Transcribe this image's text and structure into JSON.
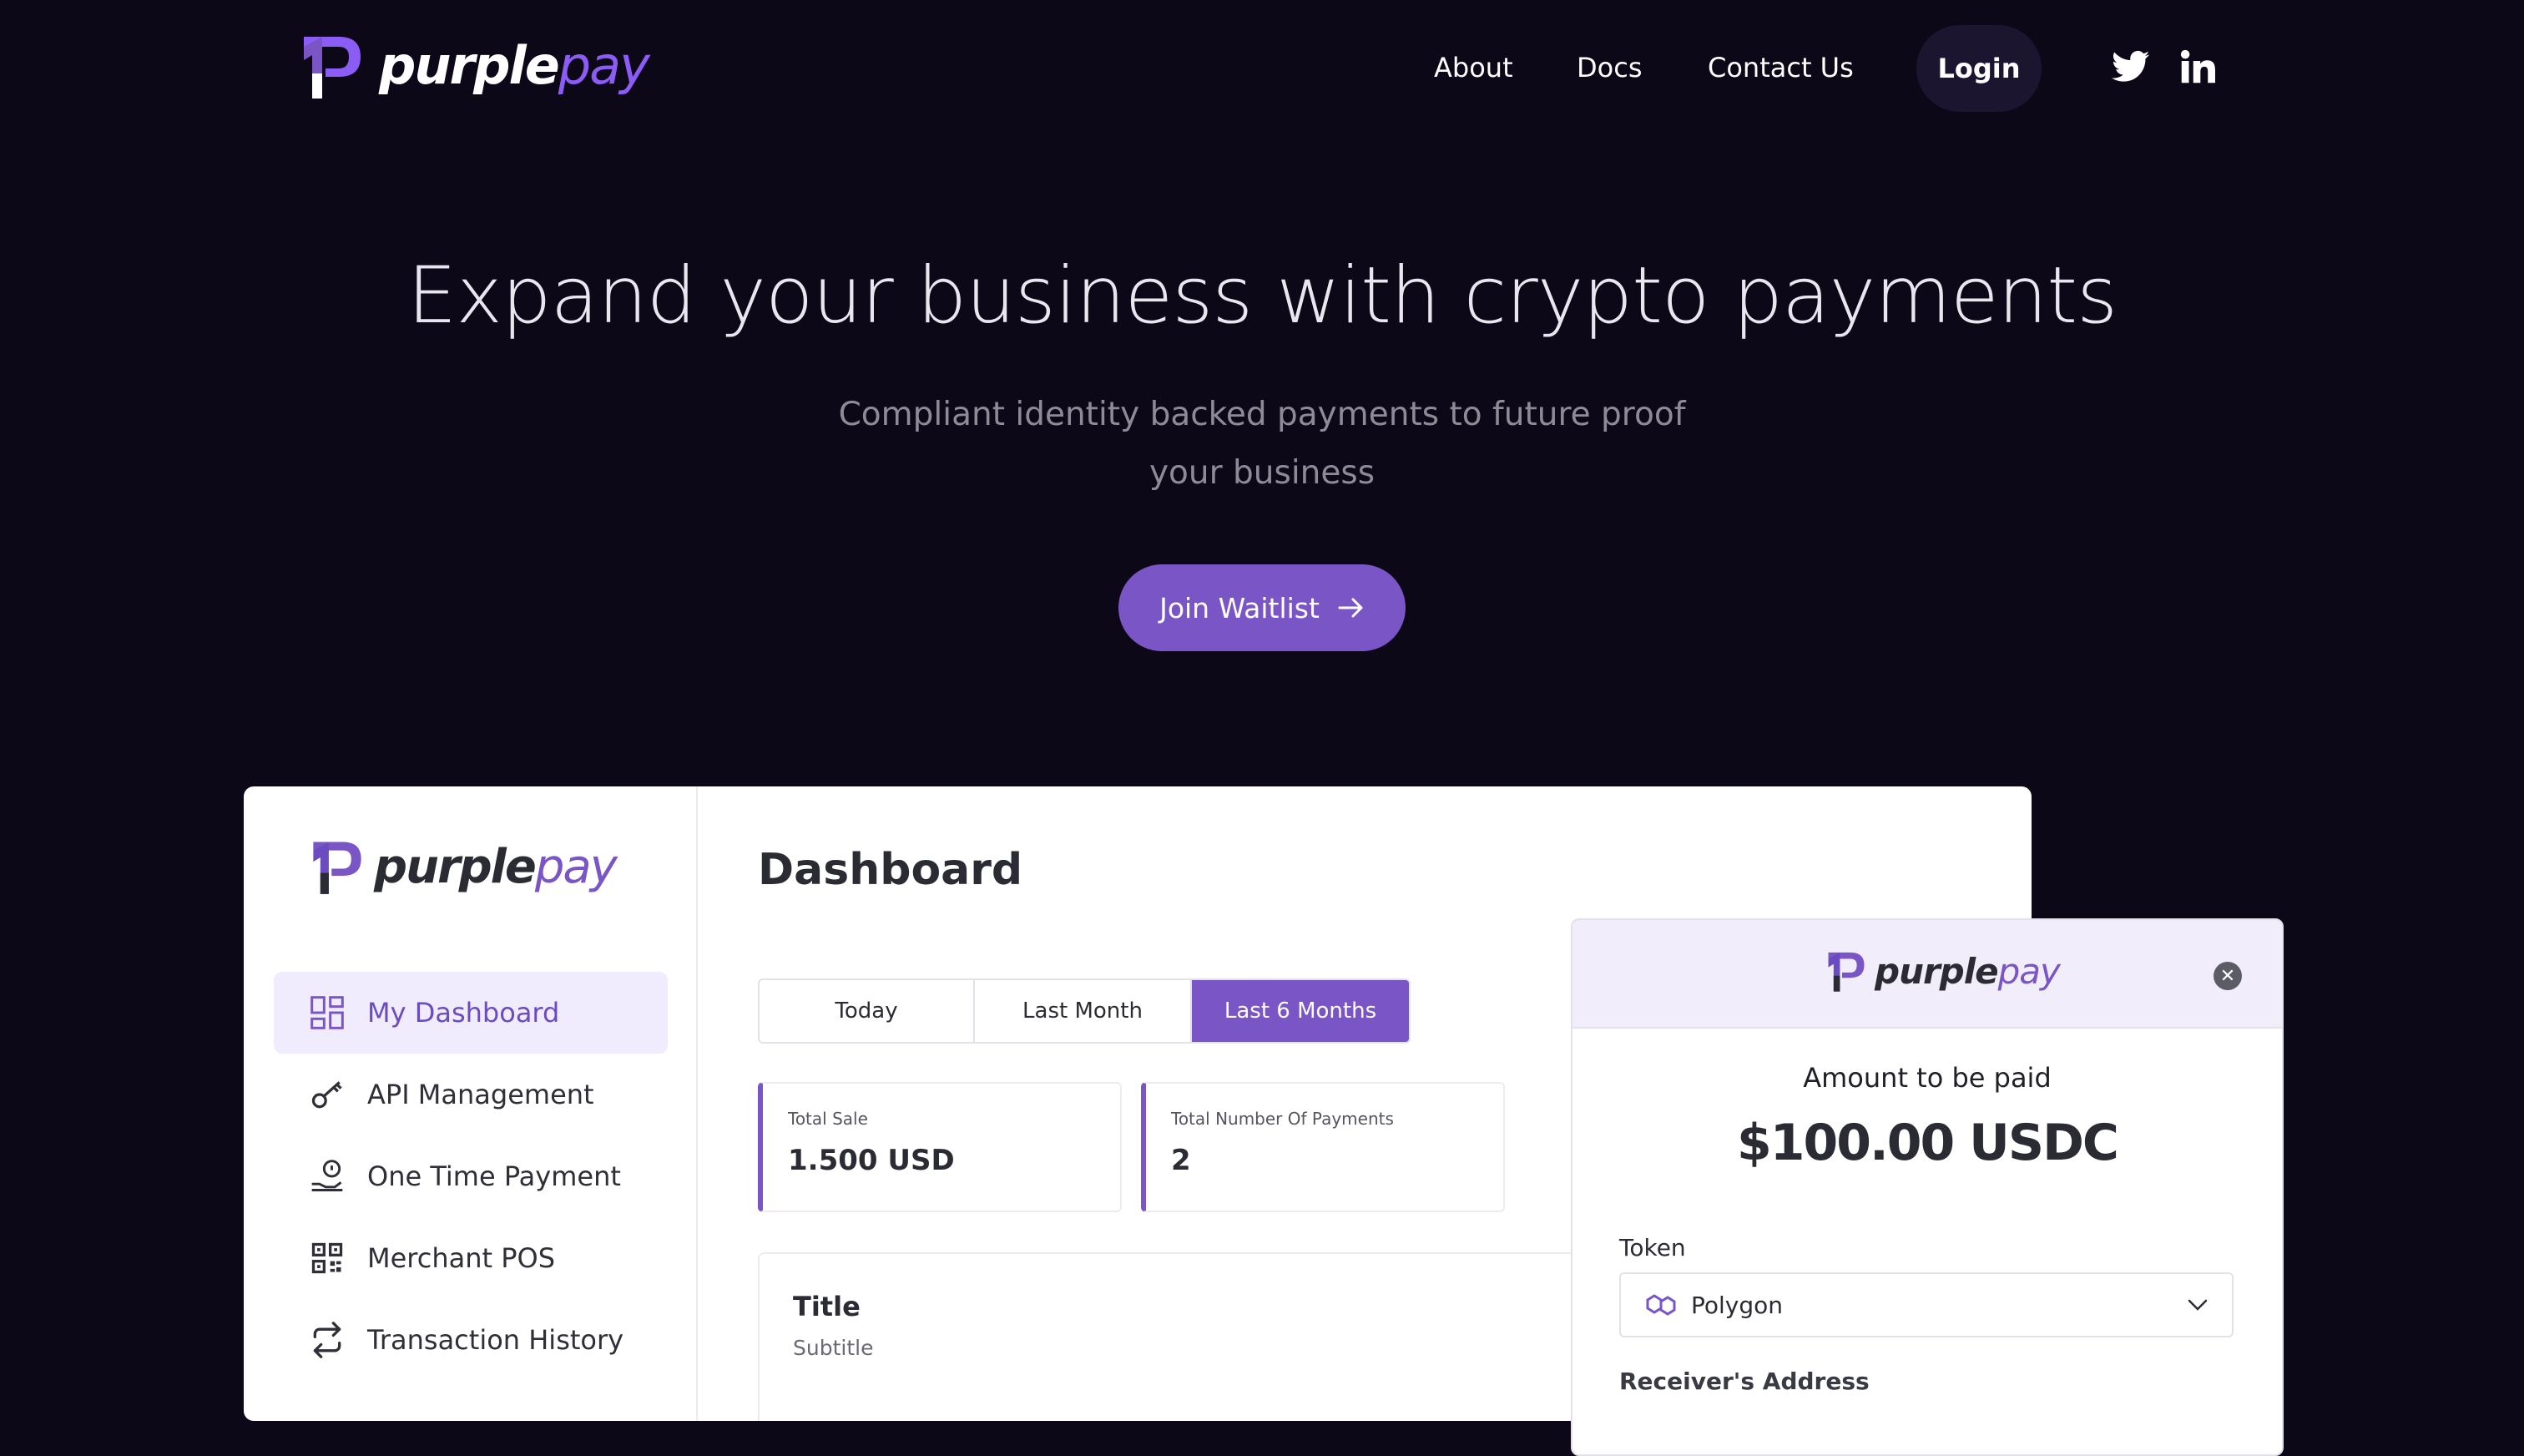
{
  "brand": {
    "name_part1": "purple",
    "name_part2": "pay"
  },
  "nav": {
    "links": [
      "About",
      "Docs",
      "Contact Us"
    ],
    "login": "Login",
    "social": [
      "twitter-icon",
      "linkedin-icon"
    ]
  },
  "hero": {
    "title": "Expand your business with crypto payments",
    "subtitle": "Compliant identity backed payments to future proof your business",
    "cta": "Join Waitlist"
  },
  "dashboard": {
    "sidebar": [
      {
        "label": "My Dashboard",
        "icon": "dashboard-icon",
        "active": true
      },
      {
        "label": "API Management",
        "icon": "key-icon",
        "active": false
      },
      {
        "label": "One Time Payment",
        "icon": "hand-coin-icon",
        "active": false
      },
      {
        "label": "Merchant POS",
        "icon": "qr-code-icon",
        "active": false
      },
      {
        "label": "Transaction History",
        "icon": "repeat-icon",
        "active": false
      }
    ],
    "title": "Dashboard",
    "ranges": [
      "Today",
      "Last Month",
      "Last 6 Months"
    ],
    "selected_range": "Last 6 Months",
    "stats": [
      {
        "label": "Total Sale",
        "value": "1.500 USD"
      },
      {
        "label": "Total Number Of Payments",
        "value": "2"
      }
    ],
    "panel": {
      "title": "Title",
      "subtitle": "Subtitle"
    }
  },
  "payment": {
    "amount_label": "Amount to be paid",
    "amount": "$100.00 USDC",
    "token_label": "Token",
    "token_value": "Polygon",
    "receiver_label": "Receiver's Address"
  },
  "colors": {
    "background": "#0d0818",
    "accent": "#7a55c6",
    "accent_light": "#8b5cf6"
  }
}
